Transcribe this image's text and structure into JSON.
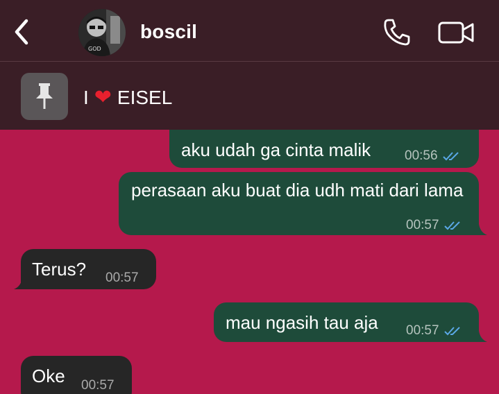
{
  "header": {
    "contact_name": "boscil",
    "avatar_text": "GOD"
  },
  "pinned": {
    "text_before": "I",
    "heart_icon": "❤",
    "text_after": "EISEL"
  },
  "messages": [
    {
      "direction": "out",
      "text": "aku udah ga cinta malik",
      "time": "00:56",
      "status": "read"
    },
    {
      "direction": "out",
      "text": "perasaan aku buat dia udh mati dari lama",
      "time": "00:57",
      "status": "read"
    },
    {
      "direction": "in",
      "text": "Terus?",
      "time": "00:57"
    },
    {
      "direction": "out",
      "text": "mau ngasih tau aja",
      "time": "00:57",
      "status": "read"
    },
    {
      "direction": "in",
      "text": "Oke",
      "time": "00:57"
    }
  ],
  "colors": {
    "background": "#b5194c",
    "header": "#3a1e26",
    "outgoing_bubble": "#1e4b3a",
    "incoming_bubble": "#262626",
    "read_tick": "#5aa8e6"
  }
}
